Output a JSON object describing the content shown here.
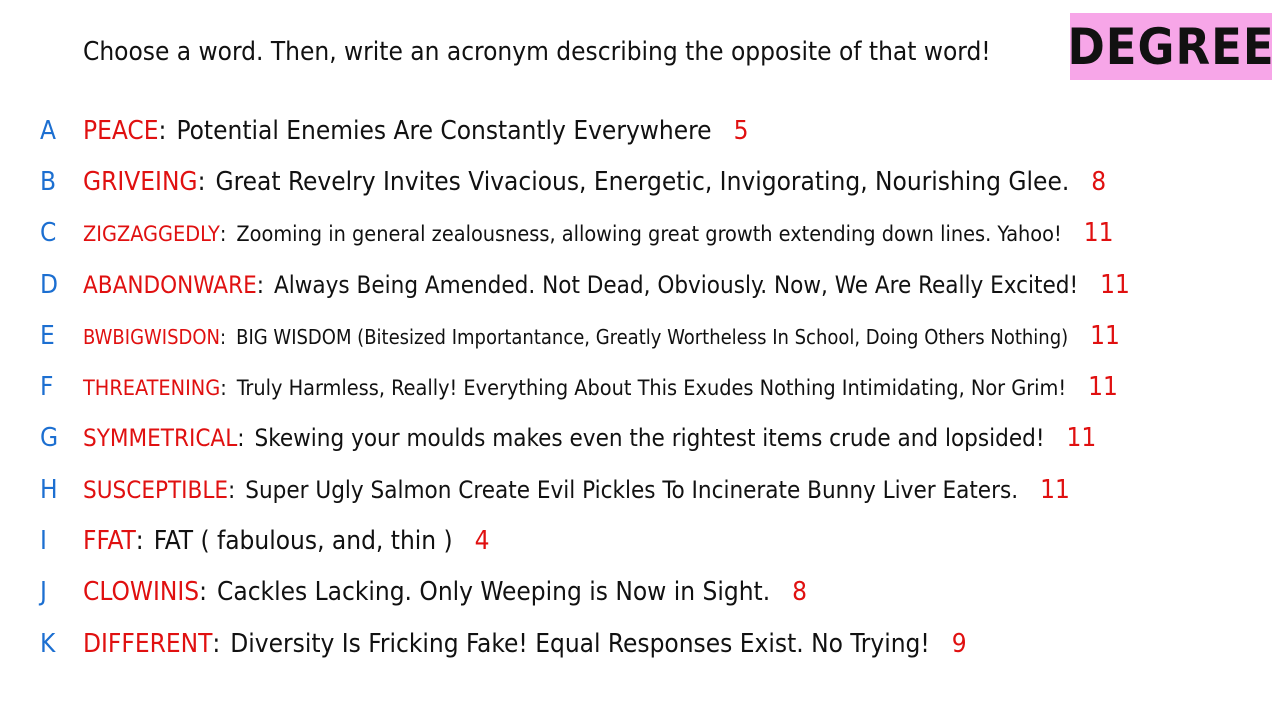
{
  "prompt": "Choose a word. Then, write an acronym describing the opposite of that word!",
  "badge": {
    "label": "DEGREE",
    "color": "#f7a6e8"
  },
  "colors": {
    "letter": "#1c6fd1",
    "word": "#e01010",
    "text": "#111111"
  },
  "entries": [
    {
      "letter": "A",
      "word": "PEACE",
      "acronym": "Potential Enemies Are Constantly Everywhere",
      "count": "5"
    },
    {
      "letter": "B",
      "word": "GRIVEING",
      "acronym": "Great Revelry Invites Vivacious, Energetic, Invigorating, Nourishing Glee.",
      "count": "8"
    },
    {
      "letter": "C",
      "word": "ZIGZAGGEDLY",
      "acronym": "Zooming in general zealousness, allowing great growth extending down lines. Yahoo!",
      "count": "11"
    },
    {
      "letter": "D",
      "word": "ABANDONWARE",
      "acronym": "Always Being Amended. Not Dead, Obviously. Now, We Are Really Excited!",
      "count": "11"
    },
    {
      "letter": "E",
      "word": "BWBIGWISDON",
      "acronym": "BIG WISDOM (Bitesized Importantance, Greatly Wortheless In School, Doing Others Nothing)",
      "count": "11"
    },
    {
      "letter": "F",
      "word": "THREATENING",
      "acronym": "Truly Harmless, Really! Everything About This Exudes Nothing Intimidating, Nor Grim!",
      "count": "11"
    },
    {
      "letter": "G",
      "word": "SYMMETRICAL",
      "acronym": "Skewing your moulds makes even the rightest items crude and lopsided!",
      "count": "11"
    },
    {
      "letter": "H",
      "word": "SUSCEPTIBLE",
      "acronym": "Super Ugly Salmon Create Evil Pickles To Incinerate Bunny Liver Eaters.",
      "count": "11"
    },
    {
      "letter": "I",
      "word": "FFAT",
      "acronym": "FAT ( fabulous, and, thin )",
      "count": "4"
    },
    {
      "letter": "J",
      "word": "CLOWINIS",
      "acronym": "Cackles Lacking. Only Weeping is Now in Sight.",
      "count": "8"
    },
    {
      "letter": "K",
      "word": "DIFFERENT",
      "acronym": "Diversity Is Fricking Fake! Equal Responses Exist. No Trying!",
      "count": "9"
    }
  ]
}
